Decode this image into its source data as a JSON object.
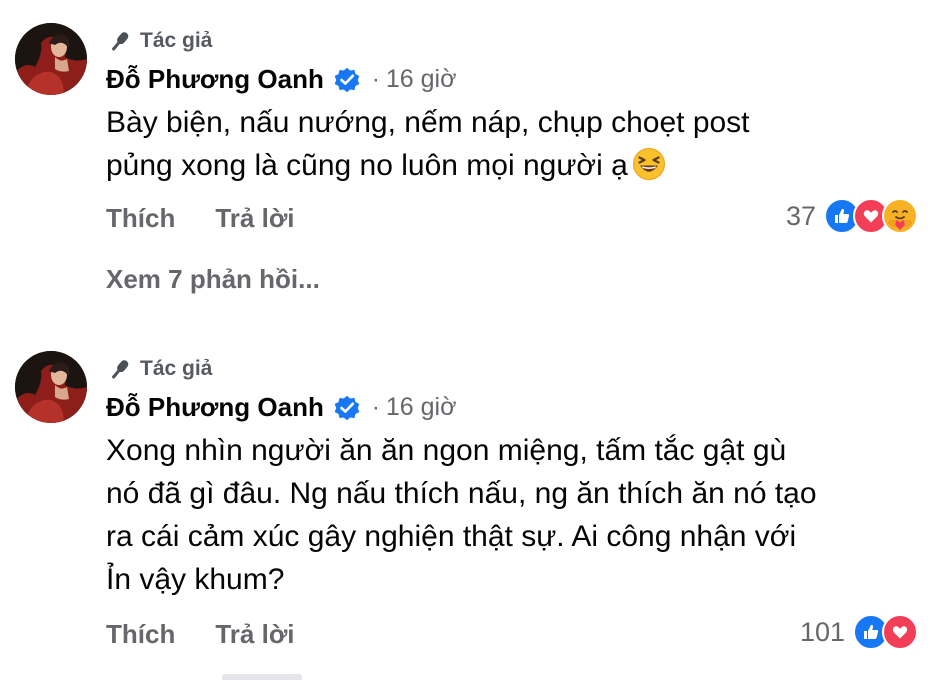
{
  "comments": [
    {
      "badge_label": "Tác giả",
      "author_name": "Đỗ Phương Oanh",
      "separator": "·",
      "timestamp": "16 giờ",
      "text_line1": "Bày biện, nấu nướng, nếm náp, chụp choẹt post",
      "text_line2": "pủng xong là cũng no luôn mọi người ạ",
      "emoji": "laughing-face",
      "like_label": "Thích",
      "reply_label": "Trả lời",
      "reaction_count": "37",
      "reactions": [
        "like",
        "love",
        "care"
      ],
      "view_replies_label": "Xem 7 phản hồi..."
    },
    {
      "badge_label": "Tác giả",
      "author_name": "Đỗ Phương Oanh",
      "separator": "·",
      "timestamp": "16 giờ",
      "text_line1": "Xong nhìn người ăn ăn ngon miệng, tấm tắc gật gù",
      "text_line2": "nó đã gì đâu. Ng nấu thích nấu, ng ăn thích ăn nó tạo",
      "text_line3": "ra cái cảm xúc gây nghiện thật sự. Ai công nhận với",
      "text_line4": "Ỉn vậy khum?",
      "like_label": "Thích",
      "reply_label": "Trả lời",
      "reaction_count": "101",
      "reactions": [
        "like",
        "love"
      ]
    }
  ],
  "colors": {
    "text_primary": "#050505",
    "text_secondary": "#65676b",
    "verified_blue": "#1877f2",
    "like_blue": "#1877f2",
    "love_red": "#f33e58",
    "care_yellow": "#f7b125"
  }
}
